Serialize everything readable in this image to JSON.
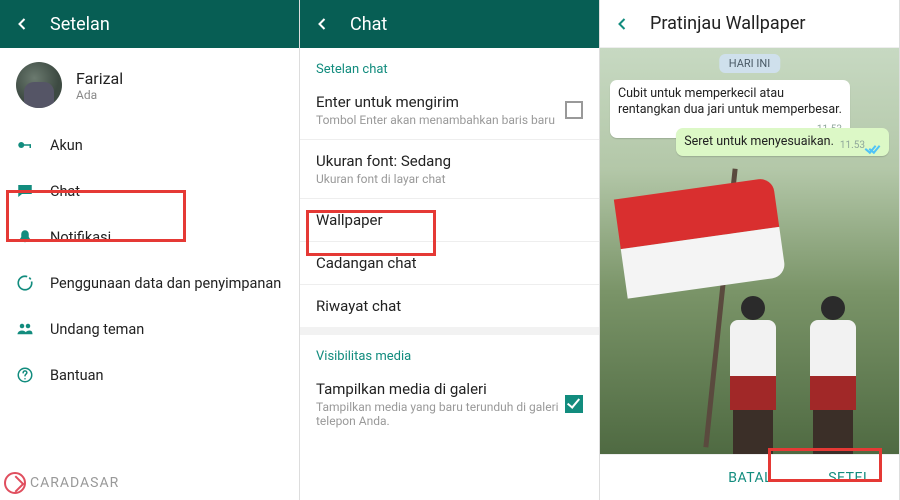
{
  "panel1": {
    "title": "Setelan",
    "profile": {
      "name": "Farizal",
      "status": "Ada"
    },
    "items": [
      {
        "label": "Akun"
      },
      {
        "label": "Chat"
      },
      {
        "label": "Notifikasi"
      },
      {
        "label": "Penggunaan data dan penyimpanan"
      },
      {
        "label": "Undang teman"
      },
      {
        "label": "Bantuan"
      }
    ]
  },
  "panel2": {
    "title": "Chat",
    "section_chat": "Setelan chat",
    "items": {
      "enter": {
        "primary": "Enter untuk mengirim",
        "secondary": "Tombol Enter akan menambahkan baris baru"
      },
      "font": {
        "primary": "Ukuran font: Sedang",
        "secondary": "Ukuran font di layar chat"
      },
      "wallpaper": {
        "primary": "Wallpaper"
      },
      "backup": {
        "primary": "Cadangan chat"
      },
      "history": {
        "primary": "Riwayat chat"
      }
    },
    "section_media": "Visibilitas media",
    "media": {
      "primary": "Tampilkan media di galeri",
      "secondary": "Tampilkan media yang baru terunduh di galeri telepon Anda."
    }
  },
  "panel3": {
    "title": "Pratinjau Wallpaper",
    "date": "HARI INI",
    "bubble_in": "Cubit untuk memperkecil atau rentangkan dua jari untuk memperbesar.",
    "bubble_out": "Seret untuk menyesuaikan.",
    "time": "11.53",
    "cancel": "BATAL",
    "set": "SETEL"
  },
  "watermark": "CARADASAR"
}
